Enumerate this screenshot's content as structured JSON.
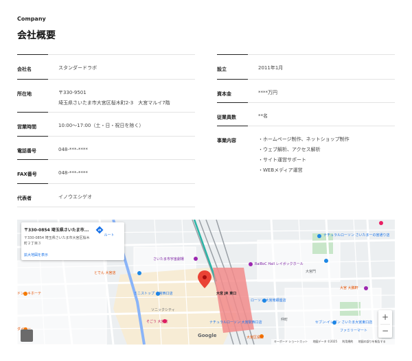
{
  "header": {
    "eyebrow": "Company",
    "title": "会社概要"
  },
  "info_left": [
    {
      "label": "会社名",
      "lines": [
        "スタンダードラボ"
      ]
    },
    {
      "label": "所在地",
      "lines": [
        "〒330-9501",
        "埼玉県さいたま市大宮区桜木町2-3　大宮マルイ7階"
      ]
    },
    {
      "label": "営業時間",
      "lines": [
        "10:00〜17:00（土・日・祝日を除く）"
      ]
    },
    {
      "label": "電話番号",
      "lines": [
        "048-***-****"
      ]
    },
    {
      "label": "FAX番号",
      "lines": [
        "048-***-****"
      ]
    },
    {
      "label": "代表者",
      "lines": [
        "イノウエシゲオ"
      ]
    }
  ],
  "info_right": [
    {
      "label": "設立",
      "lines": [
        "2011年1月"
      ]
    },
    {
      "label": "資本金",
      "lines": [
        "****万円"
      ]
    },
    {
      "label": "従業員数",
      "lines": [
        "**名"
      ]
    },
    {
      "label": "事業内容",
      "lines": [
        "・ホームページ制作、ネットショップ制作",
        "・ウェブ解析、アクセス解析",
        "・サイト運営サポート",
        "・WEBメディア運営"
      ]
    }
  ],
  "map": {
    "card": {
      "title": "〒330-0854 埼玉県さいたま市...",
      "address": "〒330-0854 埼玉県さいたま市大宮区桜木町２丁目３",
      "route_label": "ルート",
      "larger_map_link": "拡大地図を表示"
    },
    "labels": [
      "さいたま市宇宙劇場",
      "ナチュラルローソン さいたま一の宮通り店",
      "RaiBoC Hall レイボックホール",
      "とでん 大宮店",
      "ミニストップ 大宮西口店",
      "大宮 JR 東口",
      "ローソン 大宮南銀座店",
      "大宮門",
      "大宮 大鵬軒",
      "ソニックシティ",
      "そごう 大宮店",
      "ナチュラルローソン 大宮駅西口店",
      "セブン-イレブン さいたま大宮東口店",
      "ファミリーマート",
      "仲町",
      "ドン・キホーテ",
      "ダイソー",
      "大宮区役所"
    ],
    "zoom_in": "+",
    "zoom_out": "−",
    "google": "Google",
    "footer": [
      "キーボード ショートカット",
      "地図データ ©2025",
      "利用規約",
      "地図の誤りを報告する"
    ],
    "colors": {
      "pin": "#ea4335",
      "station": "#f28b8b",
      "rail": "#9aa0a6",
      "park": "#c8e6c9"
    }
  }
}
